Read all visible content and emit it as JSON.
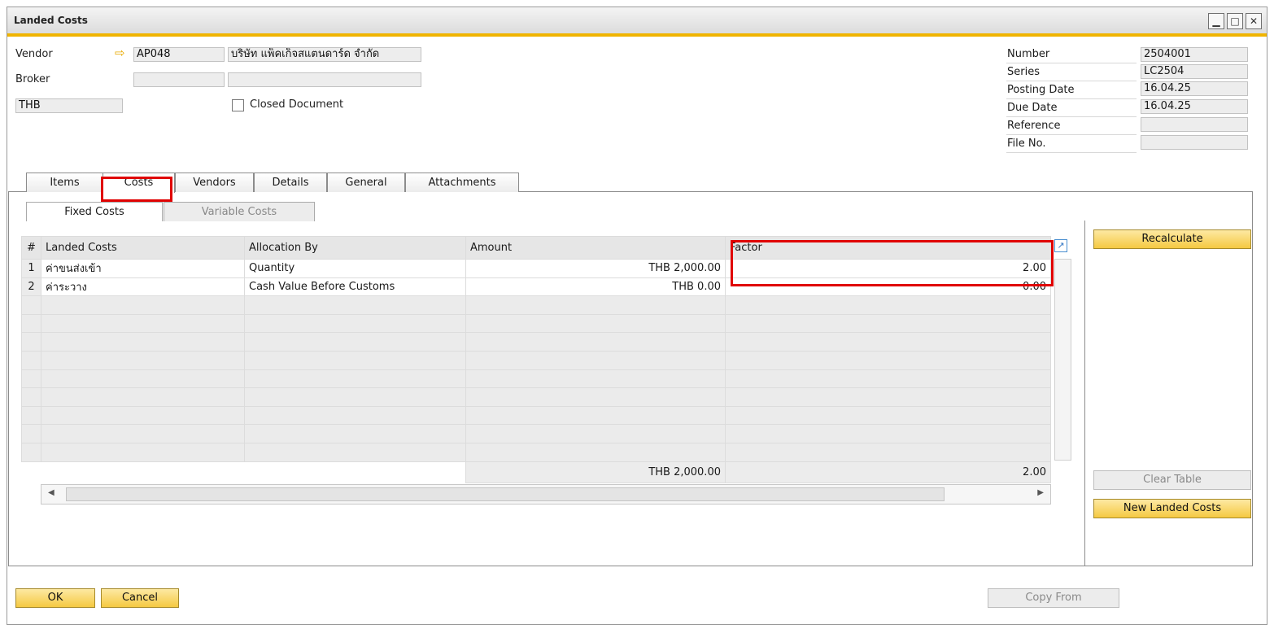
{
  "window": {
    "title": "Landed Costs",
    "controls": [
      "minimize-icon",
      "maximize-icon",
      "close-icon"
    ]
  },
  "header": {
    "vendor_label": "Vendor",
    "vendor_code": "AP048",
    "vendor_name": "บริษัท แพ็คเก็จสแตนดาร์ด จำกัด",
    "broker_label": "Broker",
    "broker_code": "",
    "broker_name": "",
    "currency": "THB",
    "closed_document_label": "Closed Document",
    "closed_document_checked": false
  },
  "doc_info": [
    {
      "label": "Number",
      "value": "2504001"
    },
    {
      "label": "Series",
      "value": "LC2504"
    },
    {
      "label": "Posting Date",
      "value": "16.04.25"
    },
    {
      "label": "Due Date",
      "value": "16.04.25"
    },
    {
      "label": "Reference",
      "value": ""
    },
    {
      "label": "File No.",
      "value": ""
    }
  ],
  "tabs": [
    "Items",
    "Costs",
    "Vendors",
    "Details",
    "General",
    "Attachments"
  ],
  "active_tab": "Costs",
  "subtabs": [
    "Fixed Costs",
    "Variable Costs"
  ],
  "active_subtab": "Fixed Costs",
  "grid": {
    "columns": [
      "#",
      "Landed Costs",
      "Allocation By",
      "Amount",
      "Factor"
    ],
    "rows": [
      {
        "num": "1",
        "landed_cost": "ค่าขนส่งเข้า",
        "allocation": "Quantity",
        "amount": "THB 2,000.00",
        "factor": "2.00"
      },
      {
        "num": "2",
        "landed_cost": "ค่าระวาง",
        "allocation": "Cash Value Before Customs",
        "amount": "THB 0.00",
        "factor": "0.00"
      }
    ],
    "totals": {
      "amount": "THB 2,000.00",
      "factor": "2.00"
    }
  },
  "buttons": {
    "recalculate": "Recalculate",
    "clear_table": "Clear Table",
    "new_landed_costs": "New Landed Costs",
    "ok": "OK",
    "cancel": "Cancel",
    "copy_from": "Copy From"
  },
  "colors": {
    "accent": "#f5c942",
    "highlight": "#e00000",
    "title_bar_stripe": "#f0b400"
  }
}
